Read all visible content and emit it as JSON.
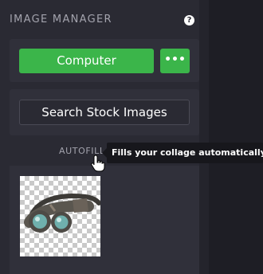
{
  "header": {
    "title": "IMAGE MANAGER",
    "help_glyph": "?"
  },
  "upload": {
    "computer_label": "Computer",
    "more_label": "•••"
  },
  "stock": {
    "search_label": "Search Stock Images"
  },
  "autofill": {
    "label": "AUTOFILL",
    "tooltip": "Fills your collage automatically"
  },
  "images": [
    {
      "icon": "goggles-image"
    }
  ],
  "colors": {
    "accent_green": "#3bb54a",
    "panel_bg": "#2a2a33",
    "tooltip_bg": "#17171c"
  }
}
